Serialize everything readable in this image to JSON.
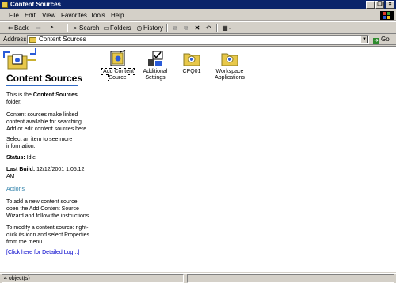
{
  "window": {
    "title": "Content Sources"
  },
  "menu": [
    "File",
    "Edit",
    "View",
    "Favorites",
    "Tools",
    "Help"
  ],
  "toolbar": {
    "back": "Back",
    "search": "Search",
    "folders": "Folders",
    "history": "History"
  },
  "address": {
    "label": "Address",
    "value": "Content Sources",
    "go": "Go"
  },
  "panel": {
    "heading": "Content Sources",
    "intro_prefix": "This is the ",
    "intro_bold": "Content Sources",
    "intro_suffix": " folder.",
    "description": "Content sources make linked content available for searching. Add or edit content sources here.",
    "select_hint": "Select an item to see more information.",
    "status_label": "Status:",
    "status_value": "Idle",
    "last_build_label": "Last Build:",
    "last_build_value": "12/12/2001 1:05:12 AM",
    "actions_label": "Actions",
    "add_instructions": "To add a new content source: open the Add Content Source Wizard and follow the instructions.",
    "modify_instructions": "To modify a content source: right-click its icon and select Properties from the menu.",
    "log_link": "[Click here for Detailed Log...]"
  },
  "items": [
    {
      "label": "Add Content Source",
      "icon": "wizard-icon"
    },
    {
      "label": "Additional Settings",
      "icon": "settings-checklist-icon"
    },
    {
      "label": "CPQ01",
      "icon": "content-folder-icon"
    },
    {
      "label": "Workspace Applications",
      "icon": "content-folder-icon"
    }
  ],
  "statusbar": {
    "text": "4 object(s)"
  }
}
